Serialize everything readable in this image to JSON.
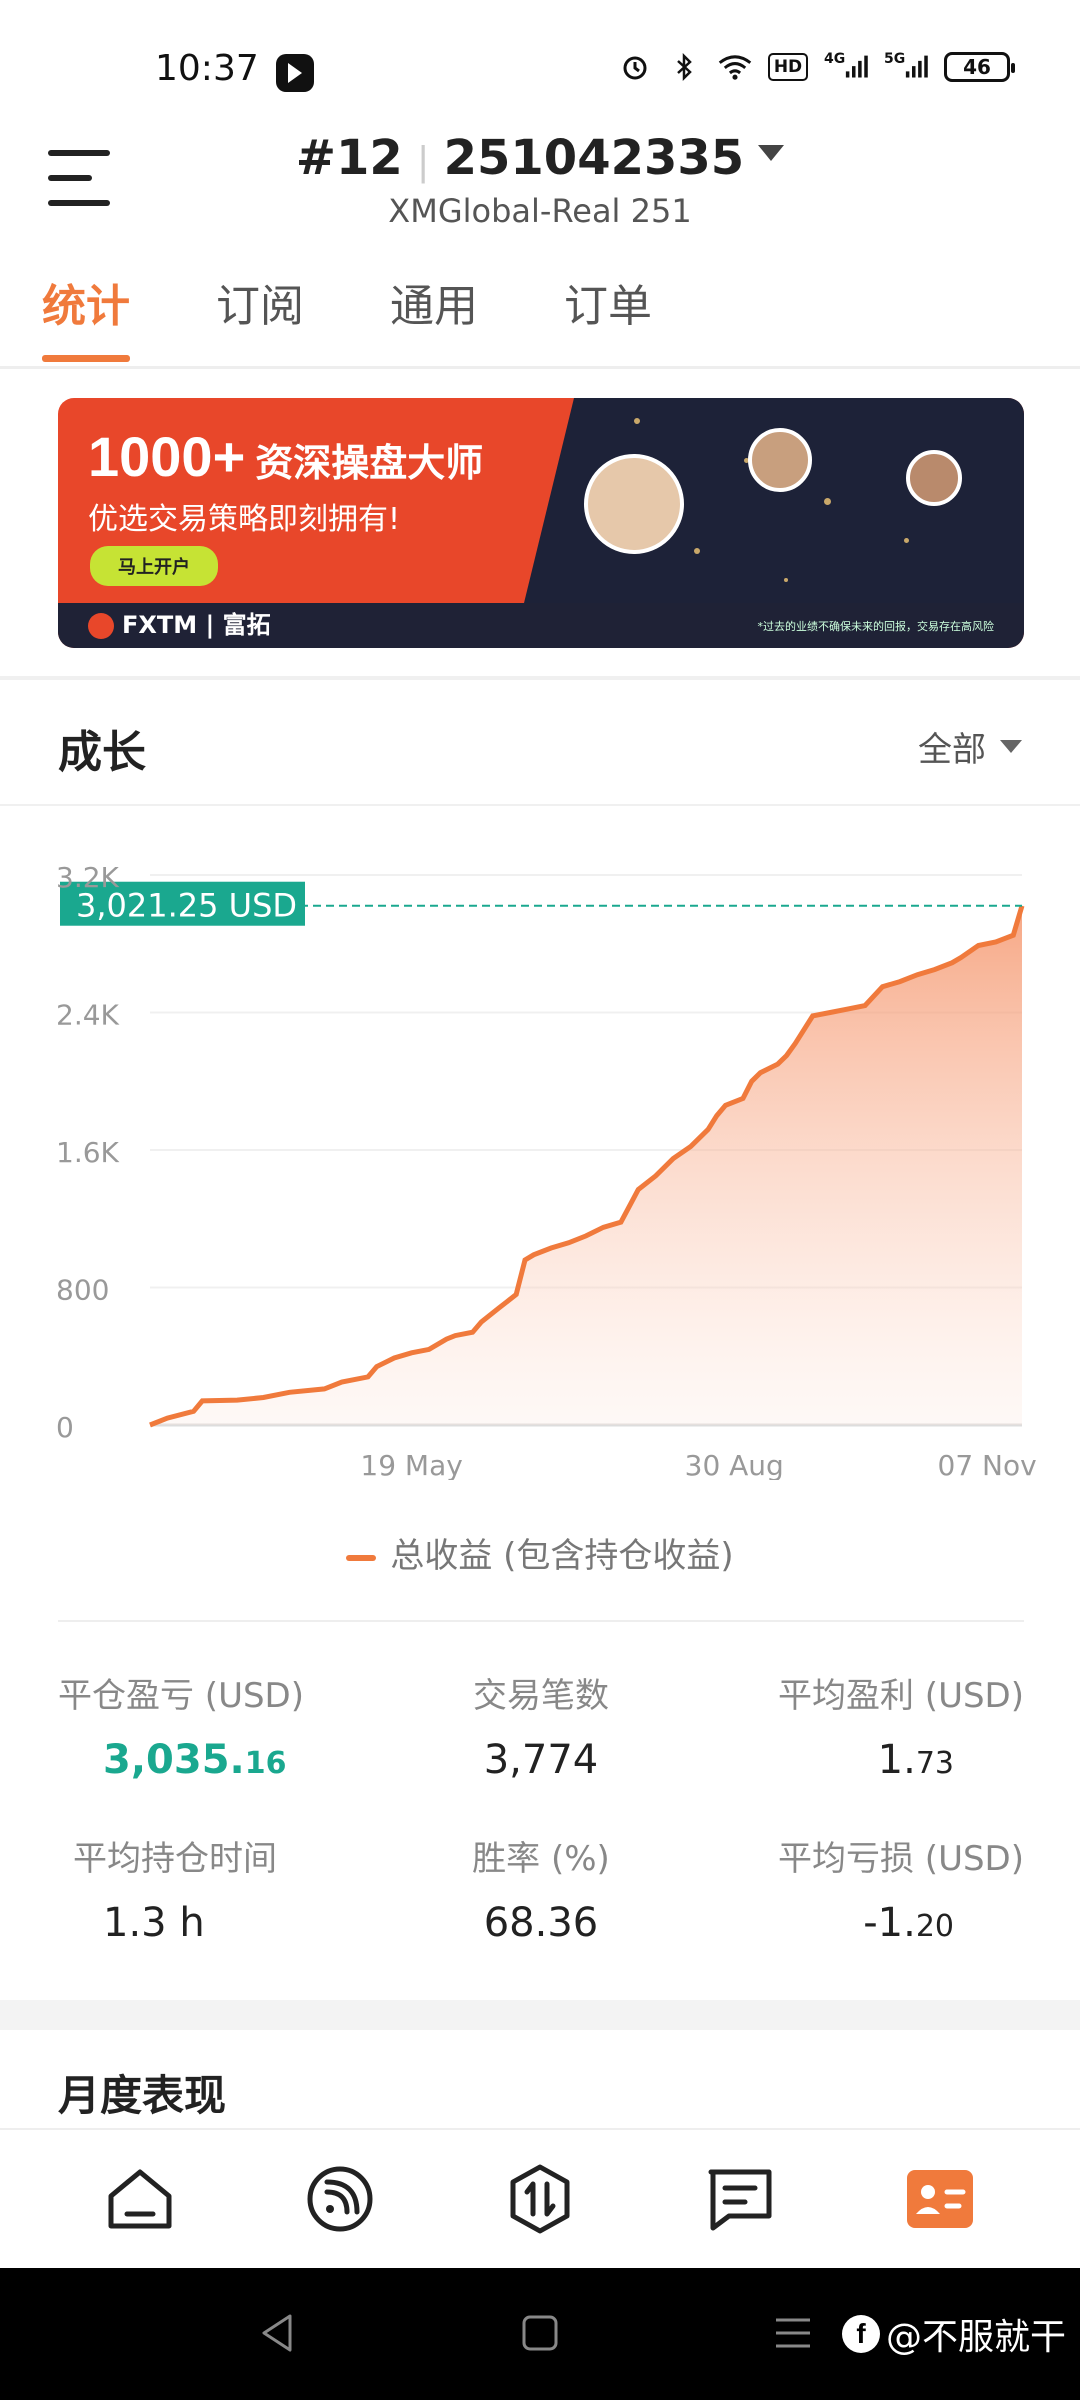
{
  "status_bar": {
    "time": "10:37",
    "network_4g": "4G",
    "network_5g": "5G",
    "hd": "HD",
    "battery": "46"
  },
  "header": {
    "account_prefix": "#12",
    "account_number": "251042335",
    "server": "XMGlobal-Real 251"
  },
  "tabs": [
    {
      "label": "统计",
      "active": true
    },
    {
      "label": "订阅",
      "active": false
    },
    {
      "label": "通用",
      "active": false
    },
    {
      "label": "订单",
      "active": false
    }
  ],
  "banner": {
    "headline_number": "1000+",
    "headline_text": "资深操盘大师",
    "subline": "优选交易策略即刻拥有!",
    "button": "马上开户",
    "brand": "FXTM | 富拓",
    "disclaimer": "*过去的业绩不确保未来的回报，交易存在高风险"
  },
  "growth": {
    "title": "成长",
    "filter": "全部"
  },
  "chart_data": {
    "type": "area",
    "current_value_label": "3,021.25 USD",
    "current_value": 3021.25,
    "y_ticks": [
      "0",
      "800",
      "1.6K",
      "2.4K",
      "3.2K"
    ],
    "ylim": [
      0,
      3200
    ],
    "x_tick_labels": [
      "19 May",
      "30 Aug",
      "07 Nov"
    ],
    "x_tick_positions": [
      0.3,
      0.67,
      0.96
    ],
    "series": [
      {
        "name": "总收益 (包含持仓收益)",
        "color": "#f07a3c",
        "points": [
          [
            0.0,
            0
          ],
          [
            0.02,
            40
          ],
          [
            0.05,
            80
          ],
          [
            0.06,
            140
          ],
          [
            0.1,
            145
          ],
          [
            0.13,
            160
          ],
          [
            0.16,
            190
          ],
          [
            0.2,
            210
          ],
          [
            0.22,
            250
          ],
          [
            0.25,
            280
          ],
          [
            0.26,
            340
          ],
          [
            0.28,
            390
          ],
          [
            0.3,
            420
          ],
          [
            0.32,
            440
          ],
          [
            0.34,
            500
          ],
          [
            0.35,
            520
          ],
          [
            0.37,
            540
          ],
          [
            0.38,
            600
          ],
          [
            0.4,
            680
          ],
          [
            0.41,
            720
          ],
          [
            0.42,
            760
          ],
          [
            0.43,
            960
          ],
          [
            0.44,
            990
          ],
          [
            0.46,
            1030
          ],
          [
            0.48,
            1060
          ],
          [
            0.5,
            1100
          ],
          [
            0.52,
            1150
          ],
          [
            0.54,
            1180
          ],
          [
            0.56,
            1370
          ],
          [
            0.58,
            1450
          ],
          [
            0.6,
            1550
          ],
          [
            0.62,
            1620
          ],
          [
            0.64,
            1720
          ],
          [
            0.65,
            1800
          ],
          [
            0.66,
            1860
          ],
          [
            0.68,
            1900
          ],
          [
            0.69,
            2000
          ],
          [
            0.7,
            2050
          ],
          [
            0.72,
            2100
          ],
          [
            0.73,
            2150
          ],
          [
            0.74,
            2220
          ],
          [
            0.76,
            2380
          ],
          [
            0.78,
            2400
          ],
          [
            0.8,
            2420
          ],
          [
            0.82,
            2440
          ],
          [
            0.84,
            2550
          ],
          [
            0.86,
            2580
          ],
          [
            0.88,
            2620
          ],
          [
            0.9,
            2650
          ],
          [
            0.92,
            2690
          ],
          [
            0.93,
            2720
          ],
          [
            0.95,
            2790
          ],
          [
            0.97,
            2810
          ],
          [
            0.98,
            2830
          ],
          [
            0.99,
            2850
          ],
          [
            1.0,
            3021
          ]
        ]
      }
    ],
    "legend_position": "bottom-center"
  },
  "legend": {
    "label": "总收益 (包含持仓收益)"
  },
  "stats": [
    {
      "label": "平仓盈亏 (USD)",
      "value_main": "3,035.",
      "value_small": "16",
      "color": "green"
    },
    {
      "label": "交易笔数",
      "value_main": "3,774",
      "value_small": "",
      "color": "default"
    },
    {
      "label": "平均盈利 (USD)",
      "value_main": "1.",
      "value_small": "73",
      "color": "default"
    },
    {
      "label": "平均持仓时间",
      "value_main": "1.3 h",
      "value_small": "",
      "color": "default"
    },
    {
      "label": "胜率 (%)",
      "value_main": "68.36",
      "value_small": "",
      "color": "default"
    },
    {
      "label": "平均亏损 (USD)",
      "value_main": "-1.",
      "value_small": "20",
      "color": "default"
    }
  ],
  "monthly": {
    "title": "月度表现"
  },
  "bottom_nav": [
    {
      "icon": "home-icon"
    },
    {
      "icon": "signal-feed-icon"
    },
    {
      "icon": "trade-icon"
    },
    {
      "icon": "chat-icon"
    },
    {
      "icon": "profile-card-icon",
      "active": true
    }
  ],
  "watermark": {
    "text": "@不服就干"
  },
  "colors": {
    "accent": "#f07a3c",
    "green": "#1aa88f",
    "banner_red": "#e8472a"
  }
}
